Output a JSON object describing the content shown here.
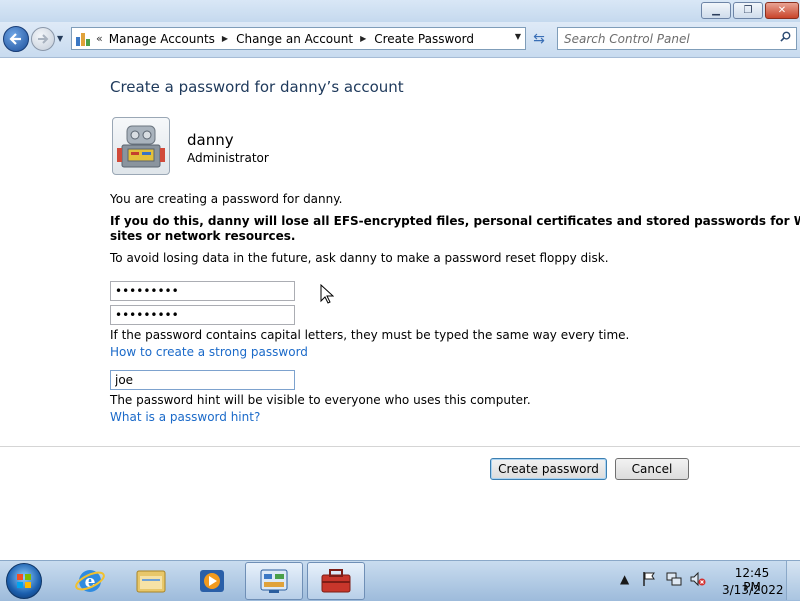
{
  "window": {
    "controls": {
      "minimize": "▁",
      "maximize": "❐",
      "close": "✕"
    }
  },
  "nav": {
    "back_icon": "arrow-left-icon",
    "forward_icon": "arrow-right-icon",
    "breadcrumb_prefix": "«",
    "breadcrumbs": [
      "Manage Accounts",
      "Change an Account",
      "Create Password"
    ],
    "search_placeholder": "Search Control Panel"
  },
  "main": {
    "title": "Create a password for danny’s account",
    "user": {
      "name": "danny",
      "role": "Administrator"
    },
    "intro": "You are creating a password for danny.",
    "warning_line1": "If you do this, danny will lose all EFS-encrypted files, personal certificates and stored passwords for Web",
    "warning_line2": "sites or network resources.",
    "advice": "To avoid losing data in the future, ask danny to make a password reset floppy disk.",
    "new_password_value": "password1",
    "confirm_password_value": "password1",
    "case_note": "If the password contains capital letters, they must be typed the same way every time.",
    "strong_password_link": "How to create a strong password",
    "hint_value": "joe",
    "hint_note": "The password hint will be visible to everyone who uses this computer.",
    "hint_link": "What is a password hint?",
    "create_button": "Create password",
    "cancel_button": "Cancel"
  },
  "taskbar": {
    "items": [
      "internet-explorer-icon",
      "windows-explorer-icon",
      "media-player-icon",
      "control-panel-icon",
      "toolbox-icon"
    ],
    "tray": [
      "show-hidden-icons-icon",
      "action-center-flag-icon",
      "network-icon",
      "volume-muted-icon"
    ],
    "time": "12:45 PM",
    "date": "3/13/2022"
  },
  "colors": {
    "title_blue": "#1e395b",
    "link_blue": "#1b6ac9",
    "chrome_blue": "#c8dbef"
  }
}
